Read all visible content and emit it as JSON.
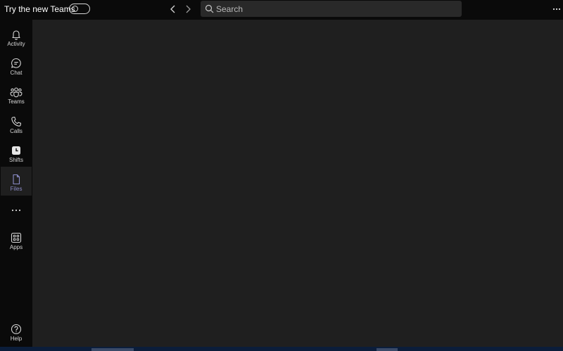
{
  "titlebar": {
    "try_new_teams_label": "Try the new Teams",
    "toggle_state": "off"
  },
  "search": {
    "placeholder": "Search"
  },
  "rail": {
    "items": [
      {
        "label": "Activity",
        "icon": "bell-icon"
      },
      {
        "label": "Chat",
        "icon": "chat-icon"
      },
      {
        "label": "Teams",
        "icon": "teams-icon"
      },
      {
        "label": "Calls",
        "icon": "phone-icon"
      },
      {
        "label": "Shifts",
        "icon": "clock-icon"
      },
      {
        "label": "Files",
        "icon": "file-icon",
        "active": true
      },
      {
        "label": "Apps",
        "icon": "apps-grid-icon"
      },
      {
        "label": "Help",
        "icon": "help-icon"
      }
    ]
  },
  "colors": {
    "background": "#0a0a0a",
    "main_pane": "#1f1f1f",
    "search_bg": "#292929",
    "active_accent": "#8b8cc7"
  }
}
